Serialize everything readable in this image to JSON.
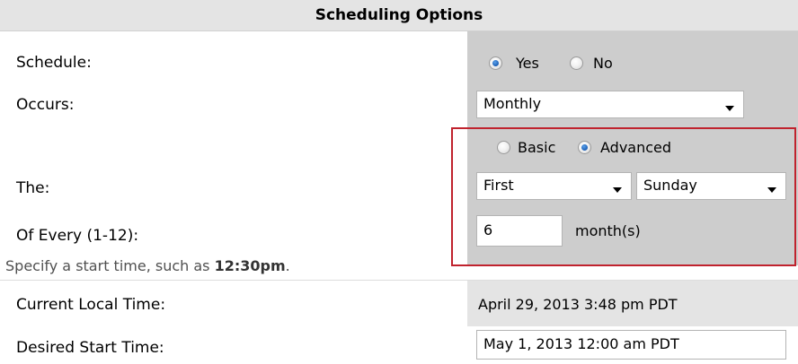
{
  "header": {
    "title": "Scheduling Options"
  },
  "schedule": {
    "label": "Schedule:",
    "options": [
      {
        "label": "Yes",
        "selected": true
      },
      {
        "label": "No",
        "selected": false
      }
    ]
  },
  "occurs": {
    "label": "Occurs:",
    "value": "Monthly"
  },
  "mode": {
    "options": [
      {
        "label": "Basic",
        "selected": false
      },
      {
        "label": "Advanced",
        "selected": true
      }
    ]
  },
  "the": {
    "label": "The:",
    "ordinal": "First",
    "weekday": "Sunday"
  },
  "of_every": {
    "label": "Of Every (1-12):",
    "value": "6",
    "unit": "month(s)"
  },
  "hint": {
    "prefix": "Specify a start time, such as ",
    "example": "12:30pm",
    "suffix": "."
  },
  "current_time": {
    "label": "Current Local Time:",
    "value": "April 29, 2013 3:48 pm PDT"
  },
  "desired_time": {
    "label": "Desired Start Time:",
    "value": "May 1, 2013 12:00 am PDT"
  },
  "colors": {
    "highlight_border": "#c0222d",
    "panel_bg": "#cdcdcd",
    "header_bg": "#e4e4e4",
    "radio_selected": "#1b5fb5"
  }
}
